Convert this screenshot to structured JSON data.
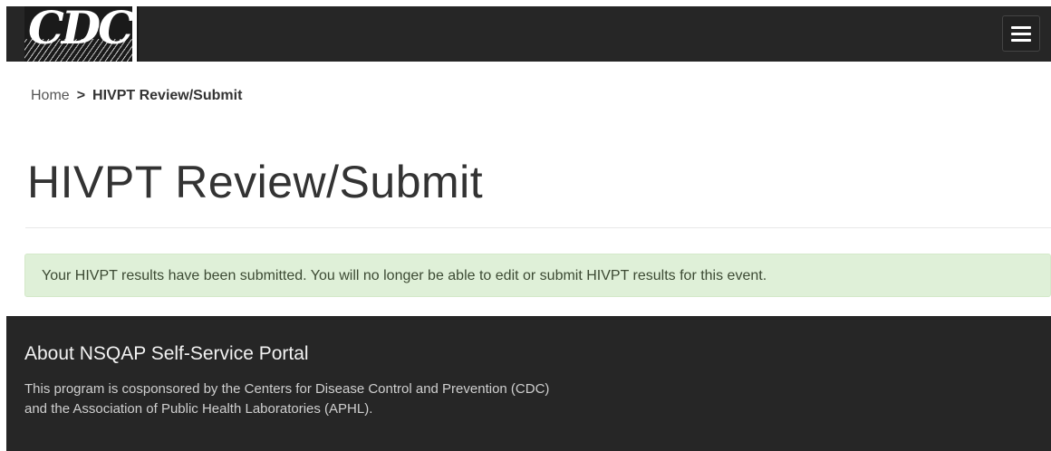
{
  "header": {
    "logo_text": "CDC",
    "menu_icon": "hamburger-menu-icon"
  },
  "breadcrumb": {
    "home": "Home",
    "separator": ">",
    "current": "HIVPT Review/Submit"
  },
  "page": {
    "title": "HIVPT Review/Submit"
  },
  "alert": {
    "message": "Your HIVPT results have been submitted. You will no longer be able to edit or submit HIVPT results for this event.",
    "color": "#dff0d8"
  },
  "footer": {
    "heading": "About NSQAP Self-Service Portal",
    "text": "This program is cosponsored by the Centers for Disease Control and Prevention (CDC) and the Association of Public Health Laboratories (APHL)."
  },
  "colors": {
    "header_bg": "#262626",
    "footer_bg": "#262626"
  }
}
